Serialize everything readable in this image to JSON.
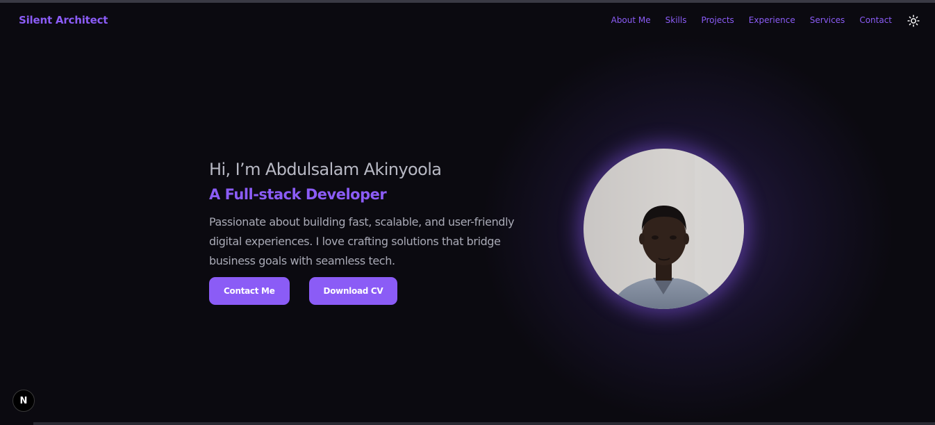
{
  "brand": {
    "name": "Silent Architect"
  },
  "nav": {
    "items": [
      "About Me",
      "Skills",
      "Projects",
      "Experience",
      "Services",
      "Contact"
    ]
  },
  "theme_toggle": {
    "icon": "sun-icon"
  },
  "hero": {
    "greeting": "Hi, I’m Abdulsalam Akinyoola",
    "role": "A Full-stack Developer",
    "description": "Passionate about building fast, scalable, and user-friendly digital experiences. I love crafting solutions that bridge business goals with seamless tech.",
    "contact_label": "Contact Me",
    "download_label": "Download CV"
  },
  "dev_badge": {
    "label": "N"
  },
  "colors": {
    "accent": "#8b5cf6",
    "background": "#0b0a10",
    "text_muted": "#a9aab6",
    "heading": "#b8b9c4"
  }
}
